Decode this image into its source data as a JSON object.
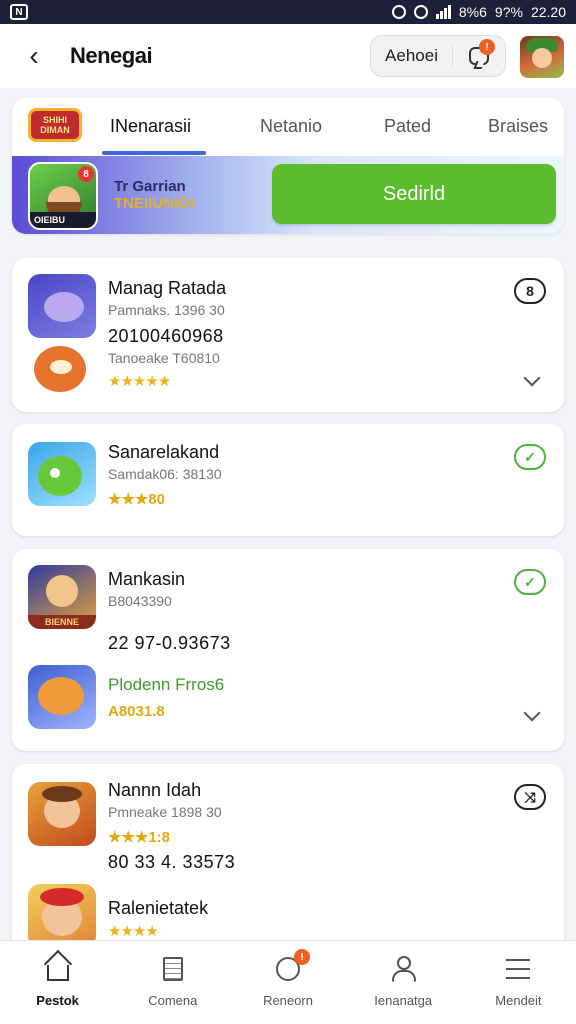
{
  "status_bar": {
    "left_icon": "N",
    "battery": "8%6",
    "signal": "9?%",
    "time": "22.20"
  },
  "header": {
    "title": "Nenegai",
    "action_label": "Aehoei",
    "notif_count": "!"
  },
  "tabs": {
    "logo_text": "SHIHI DIMAN",
    "items": [
      "INenarasii",
      "Netanio",
      "Pated",
      "Braises"
    ]
  },
  "promo": {
    "line1": "Tr Garrian",
    "line2": "TNEIIUNIOI",
    "icon_label": "OIEIBU",
    "icon_badge": "8",
    "button_label": "Sedirld"
  },
  "cards": [
    {
      "name": "Manag Ratada",
      "sub": "Pamnaks. 1396 30",
      "number": "20100460968",
      "sub2": "Tanoeake T60810",
      "stars": "★★★★★",
      "action": "8"
    },
    {
      "name": "Sanarelakand",
      "sub": "Samdak06: 38130",
      "rating": "★★★80",
      "action": "✓"
    },
    {
      "name": "Mankasin",
      "sub": "B8043390",
      "number": "22 97-0.93673",
      "green": "Plodenn Frros6",
      "rating": "A8031.8",
      "action": "✓",
      "icon_label": "BIENNE"
    },
    {
      "name": "Nannn Idah",
      "sub": "Pmneake 1898 30",
      "rating": "★★★1:8",
      "number": "80 33 4. 33573",
      "name2": "Ralenietatek",
      "stars2": "★★★★",
      "action": "⤨"
    }
  ],
  "bottom_nav": [
    {
      "label": "Pestok",
      "icon": "home-icon"
    },
    {
      "label": "Comena",
      "icon": "document-icon"
    },
    {
      "label": "Reneorn",
      "icon": "message-icon",
      "badge": "!"
    },
    {
      "label": "Ienanatga",
      "icon": "profile-icon"
    },
    {
      "label": "Mendeit",
      "icon": "menu-icon"
    }
  ],
  "colors": {
    "accent_green": "#5dbb2e",
    "tab_underline": "#3b68e0",
    "badge": "#f06022"
  }
}
